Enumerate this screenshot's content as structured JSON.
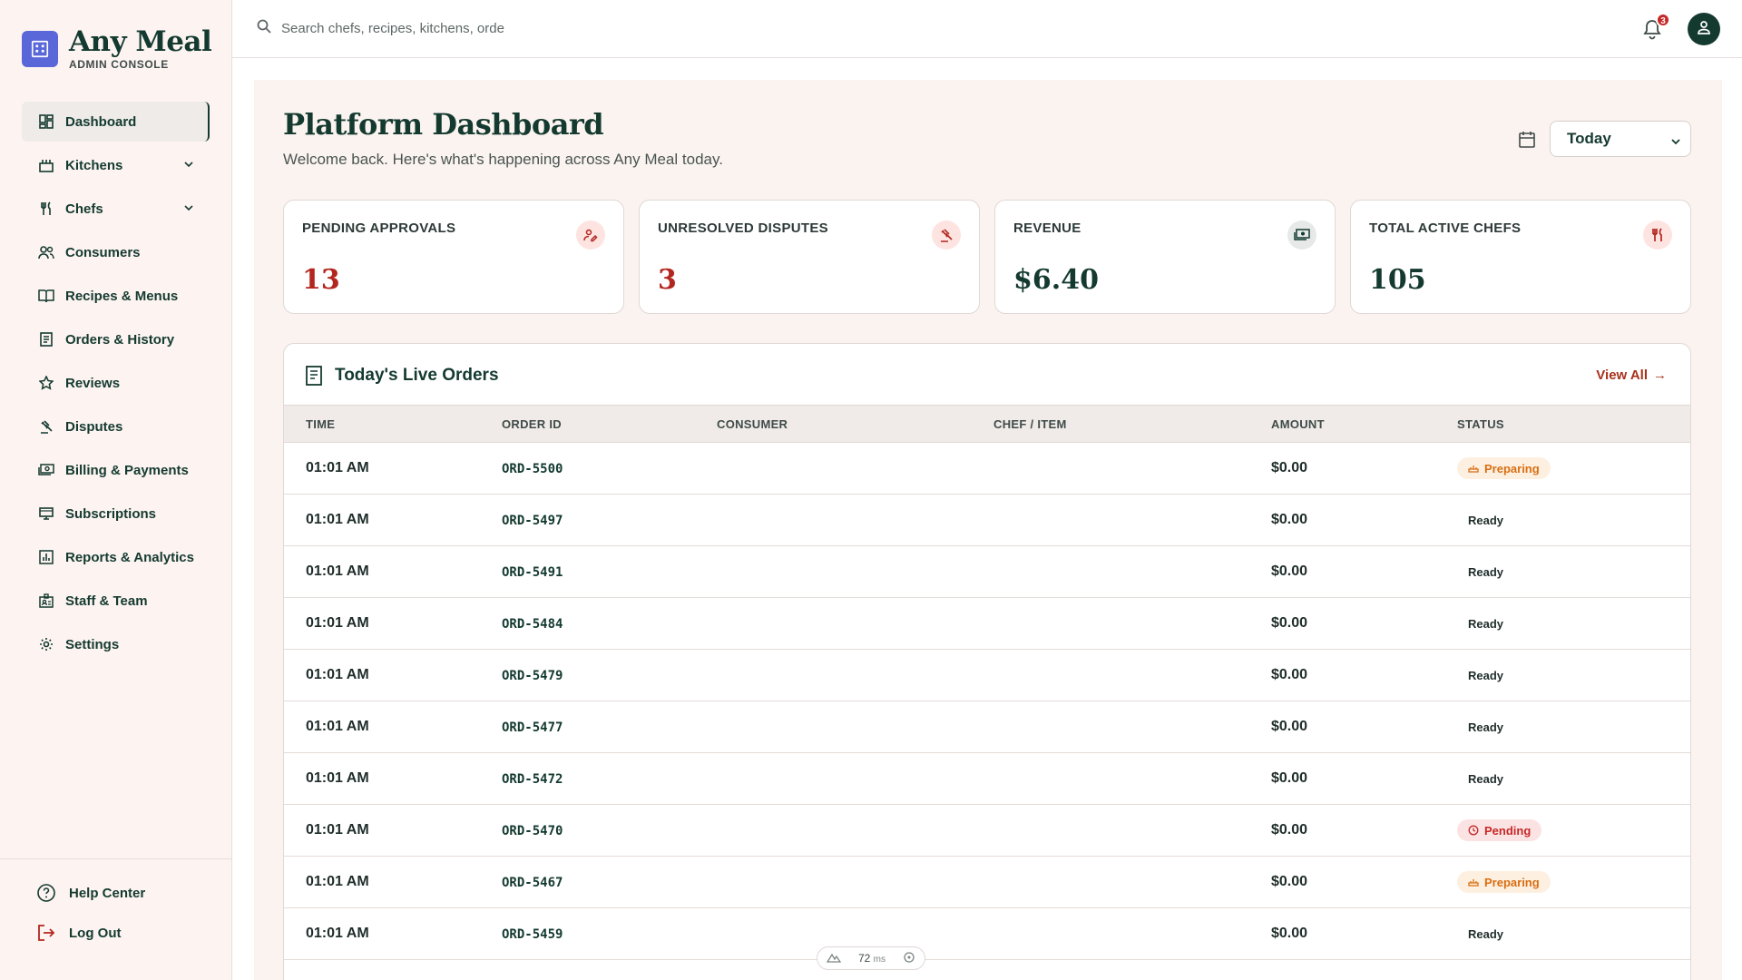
{
  "brand": {
    "title": "Any Meal",
    "subtitle": "ADMIN CONSOLE"
  },
  "sidebar": {
    "items": [
      {
        "label": "Dashboard",
        "icon": "dashboard-icon",
        "active": true
      },
      {
        "label": "Kitchens",
        "icon": "kitchen-icon",
        "expandable": true
      },
      {
        "label": "Chefs",
        "icon": "utensils-icon",
        "expandable": true
      },
      {
        "label": "Consumers",
        "icon": "users-icon"
      },
      {
        "label": "Recipes & Menus",
        "icon": "book-icon"
      },
      {
        "label": "Orders & History",
        "icon": "receipt-icon"
      },
      {
        "label": "Reviews",
        "icon": "star-icon"
      },
      {
        "label": "Disputes",
        "icon": "gavel-icon"
      },
      {
        "label": "Billing & Payments",
        "icon": "payments-icon"
      },
      {
        "label": "Subscriptions",
        "icon": "subscriptions-icon"
      },
      {
        "label": "Reports & Analytics",
        "icon": "analytics-icon"
      },
      {
        "label": "Staff & Team",
        "icon": "badge-icon"
      },
      {
        "label": "Settings",
        "icon": "gear-icon"
      }
    ],
    "bottom": [
      {
        "label": "Help Center",
        "icon": "help-icon"
      },
      {
        "label": "Log Out",
        "icon": "logout-icon"
      }
    ]
  },
  "topbar": {
    "search_placeholder": "Search chefs, recipes, kitchens, orde",
    "notification_count": "3"
  },
  "header": {
    "title": "Platform Dashboard",
    "subtitle": "Welcome back. Here's what's happening across Any Meal today.",
    "period": "Today"
  },
  "stats": [
    {
      "label": "PENDING APPROVALS",
      "value": "13",
      "color": "#b3261e",
      "icon": "person-edit-icon"
    },
    {
      "label": "UNRESOLVED DISPUTES",
      "value": "3",
      "color": "#b3261e",
      "icon": "gavel-icon"
    },
    {
      "label": "REVENUE",
      "value": "$6.40",
      "color": "#143a30",
      "icon": "cash-icon"
    },
    {
      "label": "TOTAL ACTIVE CHEFS",
      "value": "105",
      "color": "#143a30",
      "icon": "utensils-icon"
    }
  ],
  "orders": {
    "title": "Today's Live Orders",
    "view_all": "View All",
    "columns": [
      "TIME",
      "ORDER ID",
      "CONSUMER",
      "CHEF / ITEM",
      "AMOUNT",
      "STATUS"
    ],
    "rows": [
      {
        "time": "01:01 AM",
        "id": "ORD-5500",
        "consumer": "",
        "chef": "",
        "amount": "$0.00",
        "status": "Preparing"
      },
      {
        "time": "01:01 AM",
        "id": "ORD-5497",
        "consumer": "",
        "chef": "",
        "amount": "$0.00",
        "status": "Ready"
      },
      {
        "time": "01:01 AM",
        "id": "ORD-5491",
        "consumer": "",
        "chef": "",
        "amount": "$0.00",
        "status": "Ready"
      },
      {
        "time": "01:01 AM",
        "id": "ORD-5484",
        "consumer": "",
        "chef": "",
        "amount": "$0.00",
        "status": "Ready"
      },
      {
        "time": "01:01 AM",
        "id": "ORD-5479",
        "consumer": "",
        "chef": "",
        "amount": "$0.00",
        "status": "Ready"
      },
      {
        "time": "01:01 AM",
        "id": "ORD-5477",
        "consumer": "",
        "chef": "",
        "amount": "$0.00",
        "status": "Ready"
      },
      {
        "time": "01:01 AM",
        "id": "ORD-5472",
        "consumer": "",
        "chef": "",
        "amount": "$0.00",
        "status": "Ready"
      },
      {
        "time": "01:01 AM",
        "id": "ORD-5470",
        "consumer": "",
        "chef": "",
        "amount": "$0.00",
        "status": "Pending"
      },
      {
        "time": "01:01 AM",
        "id": "ORD-5467",
        "consumer": "",
        "chef": "",
        "amount": "$0.00",
        "status": "Preparing"
      },
      {
        "time": "01:01 AM",
        "id": "ORD-5459",
        "consumer": "",
        "chef": "",
        "amount": "$0.00",
        "status": "Ready"
      }
    ]
  },
  "perf": {
    "value": "72",
    "unit": "ms"
  }
}
